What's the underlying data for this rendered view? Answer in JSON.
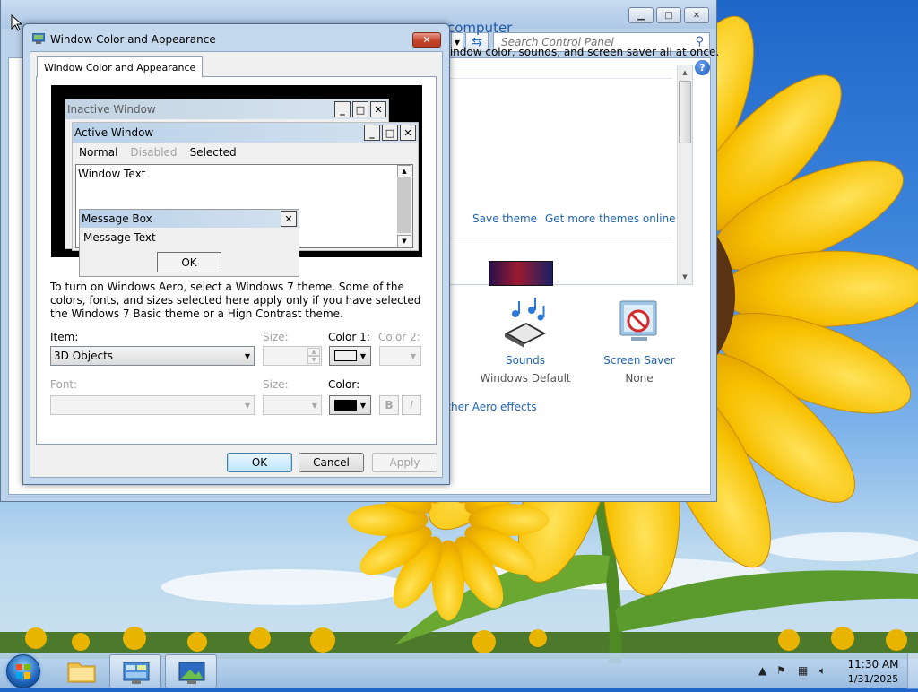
{
  "dialog": {
    "title": "Window Color and Appearance",
    "tab_label": "Window Color and Appearance",
    "preview": {
      "inactive_title": "Inactive Window",
      "active_title": "Active Window",
      "menu_normal": "Normal",
      "menu_disabled": "Disabled",
      "menu_selected": "Selected",
      "window_text": "Window Text",
      "msgbox_title": "Message Box",
      "msgbox_text": "Message Text",
      "msgbox_ok": "OK"
    },
    "info_text": "To turn on Windows Aero, select a Windows 7 theme.  Some of the colors, fonts, and sizes selected here apply only if you have selected the Windows 7 Basic theme or a High Contrast theme.",
    "item_label": "Item:",
    "item_value": "3D Objects",
    "size_label": "Size:",
    "color1_label": "Color 1:",
    "color2_label": "Color 2:",
    "color1_value": "#f0f0f0",
    "font_label": "Font:",
    "font_size_label": "Size:",
    "font_color_label": "Color:",
    "font_color_value": "#000000",
    "bold_label": "B",
    "italic_label": "I",
    "ok_button": "OK",
    "cancel_button": "Cancel",
    "apply_button": "Apply"
  },
  "control_panel": {
    "search_placeholder": "Search Control Panel",
    "heading": "computer",
    "description": "window color, sounds, and screen saver all at once.",
    "save_theme": "Save theme",
    "more_themes": "Get more themes online",
    "sounds_label": "Sounds",
    "sounds_value": "Windows Default",
    "screensaver_label": "Screen Saver",
    "screensaver_value": "None",
    "aero_link": "other Aero effects"
  },
  "caption_buttons": {
    "minimize": "▭",
    "maximize": "▭",
    "close": "✕"
  },
  "taskbar": {
    "time": "11:30 AM",
    "date": "1/31/2025"
  }
}
